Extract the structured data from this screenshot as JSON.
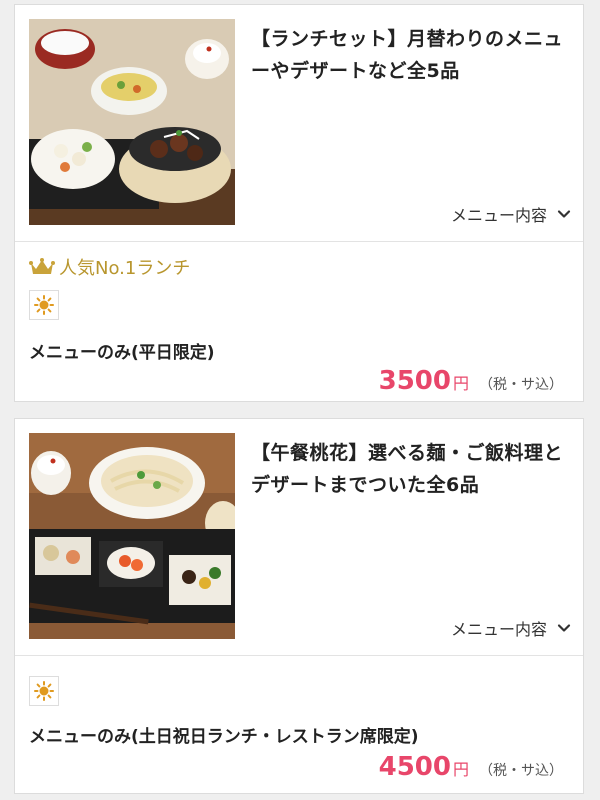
{
  "plans": [
    {
      "title": "【ランチセット】月替わりのメニューやデザートなど全5品",
      "menu_toggle": "メニュー内容",
      "popular_label": "人気No.1ランチ",
      "plan_name": "メニューのみ(平日限定)",
      "price": "3500",
      "price_unit": "円",
      "tax_note": "（税・サ込）"
    },
    {
      "title": "【午餐桃花】選べる麺・ご飯料理とデザートまでついた全6品",
      "menu_toggle": "メニュー内容",
      "plan_name": "メニューのみ(土日祝日ランチ・レストラン席限定)",
      "price": "4500",
      "price_unit": "円",
      "tax_note": "（税・サ込）"
    }
  ],
  "icons": {
    "chevron": "chevron-down-icon",
    "crown": "crown-icon",
    "sun": "sun-icon"
  },
  "colors": {
    "price": "#e8466a",
    "gold": "#b8962e",
    "sun_orange": "#e09a1f"
  }
}
